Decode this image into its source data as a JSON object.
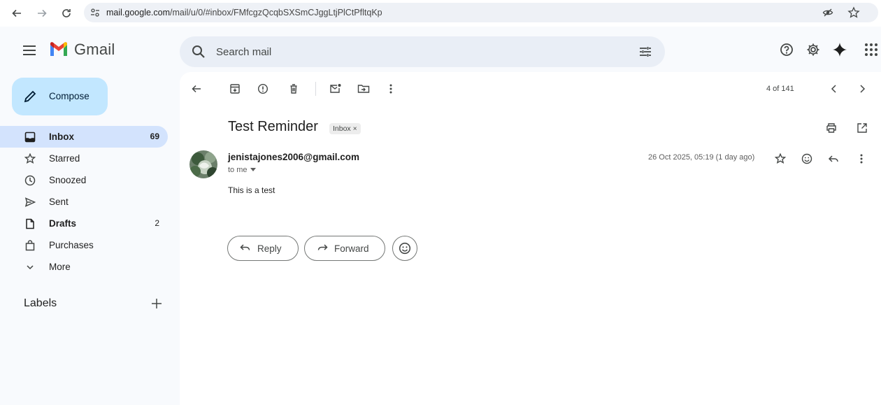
{
  "browser": {
    "url_host": "mail.google.com",
    "url_path": "/mail/u/0/#inbox/FMfcgzQcqbSXSmCJggLtjPlCtPfltqKp"
  },
  "app": {
    "name": "Gmail"
  },
  "search": {
    "placeholder": "Search mail"
  },
  "compose": {
    "label": "Compose"
  },
  "sidebar": {
    "items": [
      {
        "label": "Inbox",
        "count": "69",
        "icon": "inbox-icon",
        "active": true
      },
      {
        "label": "Starred",
        "count": "",
        "icon": "star-icon"
      },
      {
        "label": "Snoozed",
        "count": "",
        "icon": "clock-icon"
      },
      {
        "label": "Sent",
        "count": "",
        "icon": "send-icon"
      },
      {
        "label": "Drafts",
        "count": "2",
        "icon": "draft-icon"
      },
      {
        "label": "Purchases",
        "count": "",
        "icon": "shopping-bag-icon"
      },
      {
        "label": "More",
        "count": "",
        "icon": "chevron-down-icon"
      }
    ],
    "labels_title": "Labels"
  },
  "toolbar": {
    "pager": "4 of 141"
  },
  "message": {
    "subject": "Test Reminder",
    "label_chip": "Inbox",
    "label_chip_close": "×",
    "sender": "jenistajones2006@gmail.com",
    "recipient": "to me",
    "date": "26 Oct 2025, 05:19 (1 day ago)",
    "body": "This is a test"
  },
  "actions": {
    "reply": "Reply",
    "forward": "Forward"
  },
  "colors": {
    "accent": "#c2e7ff",
    "active_nav": "#d3e3fd",
    "search_bg": "#e9eef6",
    "page_bg": "#f8fafd"
  }
}
